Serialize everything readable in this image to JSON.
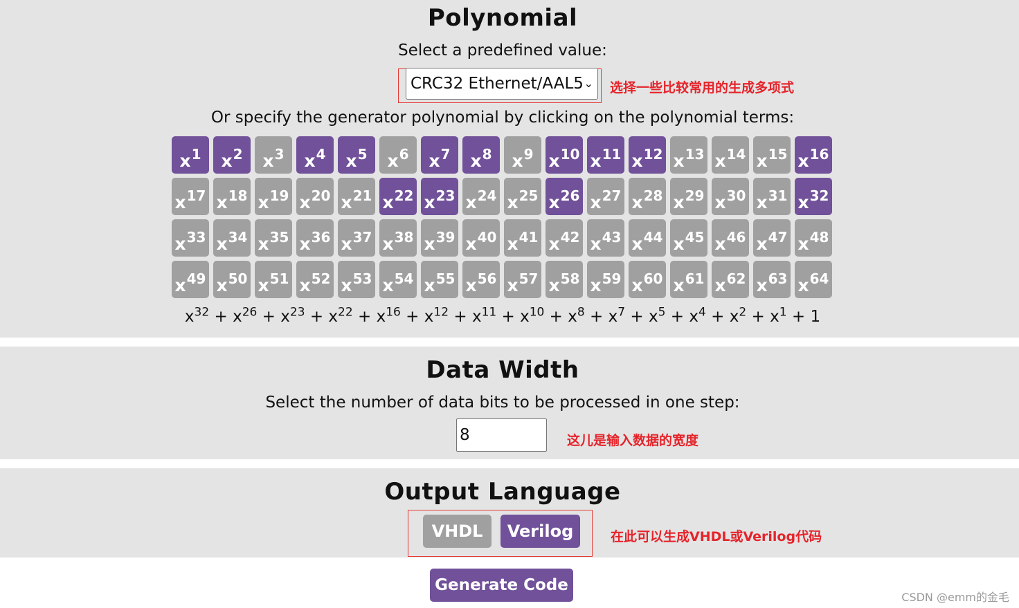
{
  "polynomial": {
    "title": "Polynomial",
    "select_prompt": "Select a predefined value:",
    "selected_value": "CRC32 Ethernet/AAL5",
    "select_annotation": "选择一些比较常用的生成多项式",
    "terms_prompt": "Or specify the generator polynomial by clicking on the polynomial terms:",
    "term_base": "x",
    "active_terms": [
      1,
      2,
      4,
      5,
      7,
      8,
      10,
      11,
      12,
      16,
      22,
      23,
      26,
      32
    ],
    "term_count": 64,
    "expression": {
      "base": "x",
      "exponents": [
        32,
        26,
        23,
        22,
        16,
        12,
        11,
        10,
        8,
        7,
        5,
        4,
        2,
        1
      ],
      "constant": "1"
    }
  },
  "data_width": {
    "title": "Data Width",
    "prompt": "Select the number of data bits to be processed in one step:",
    "value": "8",
    "annotation": "这儿是输入数据的宽度"
  },
  "output_language": {
    "title": "Output Language",
    "options": [
      "VHDL",
      "Verilog"
    ],
    "selected": "Verilog",
    "annotation": "在此可以生成VHDL或Verilog代码"
  },
  "generate_label": "Generate Code",
  "watermark": "CSDN @emm的金毛",
  "colors": {
    "active": "#71519a",
    "inactive": "#a0a0a0",
    "annotation": "#e5242b",
    "band": "#e4e4e4"
  }
}
